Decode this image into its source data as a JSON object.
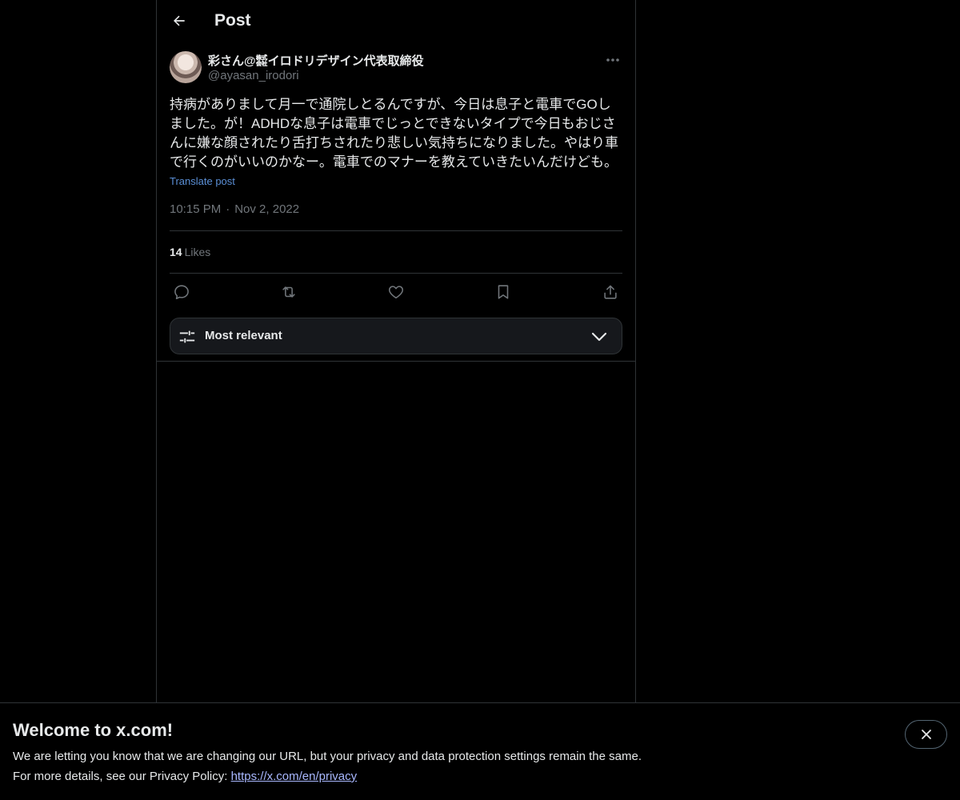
{
  "header": {
    "title": "Post"
  },
  "post": {
    "author_name": "彩さん@㍿イロドリデザイン代表取締役",
    "author_handle": "@ayasan_irodori",
    "text": "持病がありまして月一で通院しとるんですが、今日は息子と電車でGOしました。が！ADHDな息子は電車でじっとできないタイプで今日もおじさんに嫌な顔されたり舌打ちされたり悲しい気持ちになりました。やはり車で行くのがいいのかなー。電車でのマナーを教えていきたいんだけども。",
    "translate_label": "Translate post",
    "time": "10:15 PM",
    "separator": "·",
    "date": "Nov 2, 2022",
    "likes_count": "14",
    "likes_label": "Likes"
  },
  "icons": {
    "back": "arrow-left-icon",
    "more": "more-horizontal-icon",
    "reply": "reply-icon",
    "repost": "repost-icon",
    "like": "heart-icon",
    "bookmark": "bookmark-icon",
    "share": "share-icon",
    "sort": "sliders-icon",
    "chevron": "chevron-down-icon",
    "close": "close-icon"
  },
  "sort": {
    "label": "Most relevant"
  },
  "banner": {
    "title": "Welcome to x.com!",
    "line1": "We are letting you know that we are changing our URL, but your privacy and data protection settings remain the same.",
    "line2_prefix": "For more details, see our Privacy Policy: ",
    "link": "https://x.com/en/privacy"
  },
  "colors": {
    "background": "#000000",
    "text": "#e7e9ea",
    "muted": "#71767b",
    "border": "#2f3336",
    "link": "#5b8fd6",
    "banner_link": "#a9b8ff"
  }
}
